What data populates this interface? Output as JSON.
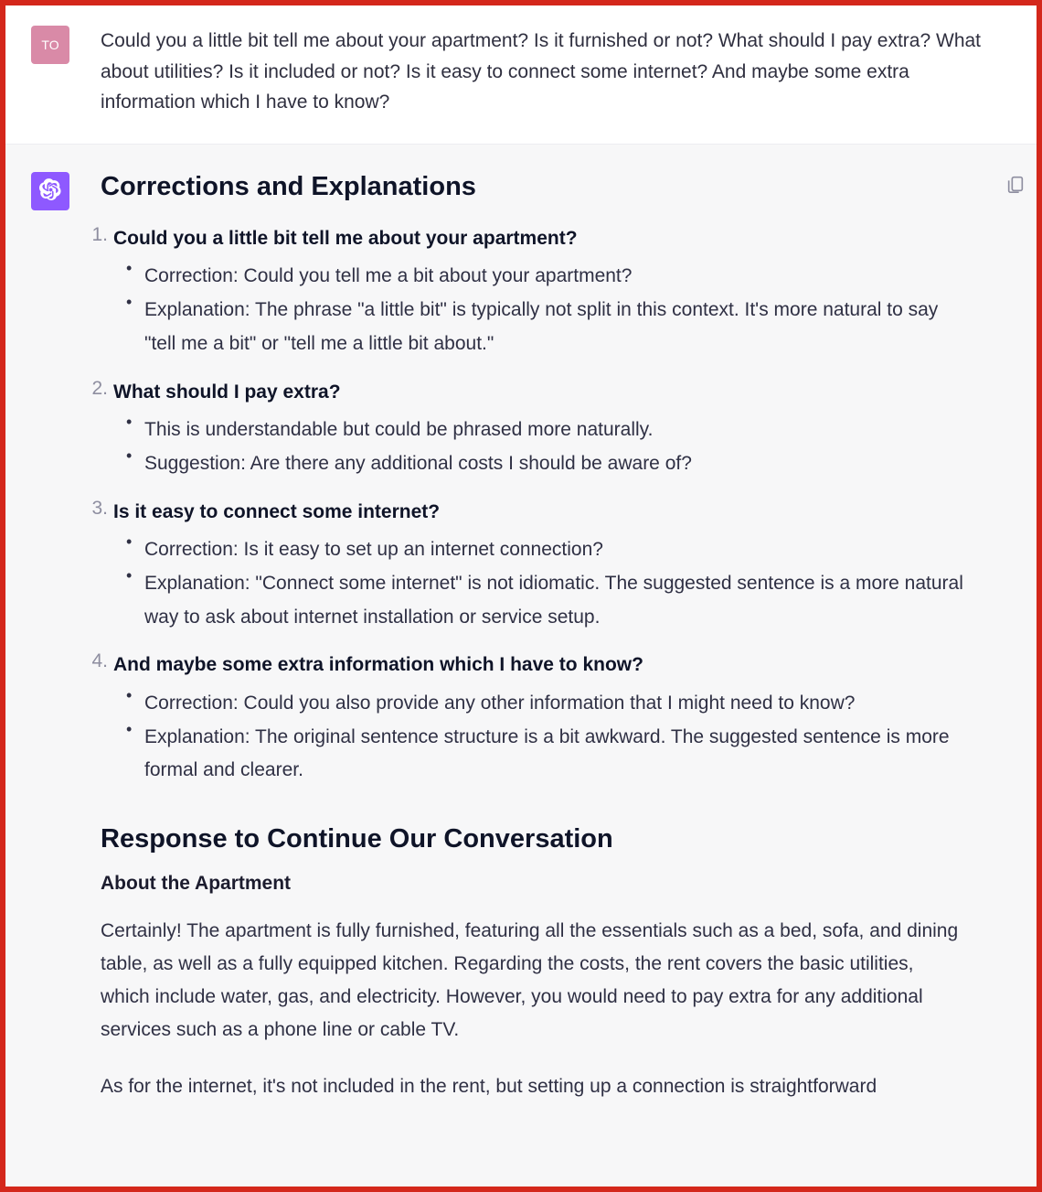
{
  "user": {
    "avatar_initials": "TO",
    "message": "Could you a little bit tell me about your apartment? Is it furnished or not? What should I pay extra? What about utilities? Is it included or not? Is it easy to connect some internet? And maybe some extra information which I have to know?"
  },
  "assistant": {
    "heading1": "Corrections and Explanations",
    "corrections": [
      {
        "title": "Could you a little bit tell me about your apartment?",
        "points": [
          "Correction: Could you tell me a bit about your apartment?",
          "Explanation: The phrase \"a little bit\" is typically not split in this context. It's more natural to say \"tell me a bit\" or \"tell me a little bit about.\""
        ]
      },
      {
        "title": "What should I pay extra?",
        "points": [
          "This is understandable but could be phrased more naturally.",
          "Suggestion: Are there any additional costs I should be aware of?"
        ]
      },
      {
        "title": "Is it easy to connect some internet?",
        "points": [
          "Correction: Is it easy to set up an internet connection?",
          "Explanation: \"Connect some internet\" is not idiomatic. The suggested sentence is a more natural way to ask about internet installation or service setup."
        ]
      },
      {
        "title": "And maybe some extra information which I have to know?",
        "points": [
          "Correction: Could you also provide any other information that I might need to know?",
          "Explanation: The original sentence structure is a bit awkward. The suggested sentence is more formal and clearer."
        ]
      }
    ],
    "heading2": "Response to Continue Our Conversation",
    "subheading": "About the Apartment",
    "paragraphs": [
      "Certainly! The apartment is fully furnished, featuring all the essentials such as a bed, sofa, and dining table, as well as a fully equipped kitchen. Regarding the costs, the rent covers the basic utilities, which include water, gas, and electricity. However, you would need to pay extra for any additional services such as a phone line or cable TV.",
      "As for the internet, it's not included in the rent, but setting up a connection is straightforward"
    ]
  }
}
